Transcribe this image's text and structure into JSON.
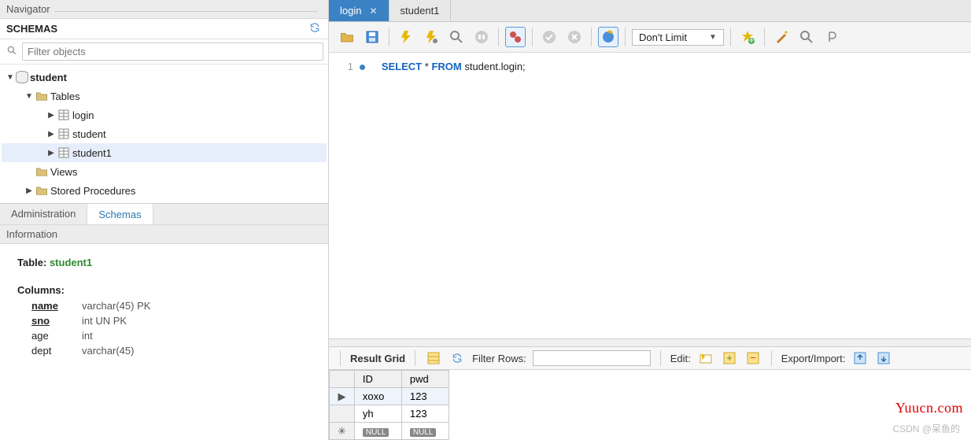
{
  "navigator": {
    "title": "Navigator"
  },
  "schemas": {
    "title": "SCHEMAS",
    "filter_placeholder": "Filter objects",
    "tree": {
      "db": "student",
      "tables_label": "Tables",
      "tables": [
        "login",
        "student",
        "student1"
      ],
      "views_label": "Views",
      "sp_label": "Stored Procedures",
      "selected": "student1"
    }
  },
  "lower_tabs": {
    "admin": "Administration",
    "schemas": "Schemas",
    "active": "schemas"
  },
  "information": {
    "title": "Information",
    "table_prefix": "Table: ",
    "table_name": "student1",
    "columns_title": "Columns:",
    "columns": [
      {
        "name": "name",
        "type": "varchar(45) PK",
        "pk": true
      },
      {
        "name": "sno",
        "type": "int UN PK",
        "pk": true
      },
      {
        "name": "age",
        "type": "int",
        "pk": false
      },
      {
        "name": "dept",
        "type": "varchar(45)",
        "pk": false
      }
    ]
  },
  "editor_tabs": [
    {
      "label": "login",
      "active": true,
      "closable": true
    },
    {
      "label": "student1",
      "active": false,
      "closable": false
    }
  ],
  "toolbar": {
    "limit": "Don't Limit"
  },
  "sql": {
    "line_no": "1",
    "tokens": {
      "select": "SELECT",
      "star": " * ",
      "from": "FROM",
      "rest": " student.login;"
    }
  },
  "result_bar": {
    "grid_label": "Result Grid",
    "filter_label": "Filter Rows:",
    "edit_label": "Edit:",
    "export_label": "Export/Import:"
  },
  "result_grid": {
    "columns": [
      "ID",
      "pwd"
    ],
    "rows": [
      {
        "cursor": true,
        "cells": [
          "xoxo",
          "123"
        ]
      },
      {
        "cursor": false,
        "cells": [
          "yh",
          "123"
        ]
      }
    ],
    "null_label": "NULL"
  },
  "watermarks": {
    "brand": "Yuucn.com",
    "csdn": "CSDN @呆鱼的"
  }
}
